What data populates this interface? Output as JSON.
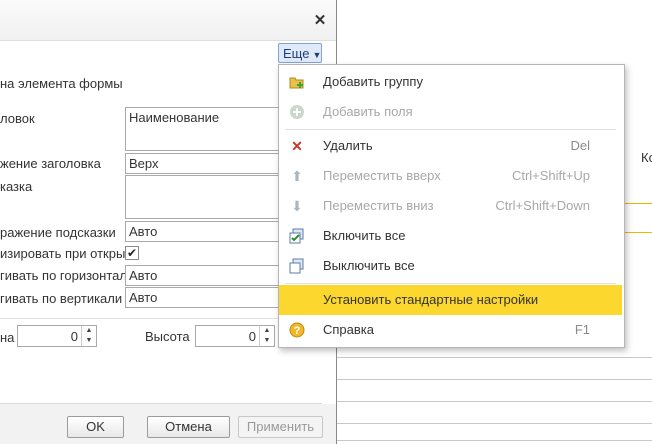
{
  "dialog": {
    "more_label": "Еще",
    "form_title": "на элемента формы",
    "labels": {
      "title": "ловок",
      "title_position": "жение заголовка",
      "hint": "казка",
      "hint_display": "ражение подсказки",
      "activate_on_open": "изировать при откры",
      "stretch_h": "гивать по горизонтал",
      "stretch_v": "гивать по вертикали",
      "width": "на",
      "height": "Высота"
    },
    "values": {
      "title": "Наименование",
      "title_position": "Верх",
      "hint": "",
      "hint_display": "Авто",
      "activate_on_open": true,
      "stretch_h": "Авто",
      "stretch_v": "Авто",
      "width": "0",
      "height": "0"
    },
    "buttons": {
      "ok": "OK",
      "cancel": "Отмена",
      "apply": "Применить"
    }
  },
  "menu": {
    "items": [
      {
        "label": "Добавить группу",
        "shortcut": "",
        "icon": "folder-add-icon",
        "enabled": true
      },
      {
        "label": "Добавить поля",
        "shortcut": "",
        "icon": "add-field-icon",
        "enabled": false
      },
      {
        "label": "Удалить",
        "shortcut": "Del",
        "icon": "delete-x-icon",
        "enabled": true
      },
      {
        "label": "Переместить вверх",
        "shortcut": "Ctrl+Shift+Up",
        "icon": "arrow-up-icon",
        "enabled": false
      },
      {
        "label": "Переместить вниз",
        "shortcut": "Ctrl+Shift+Down",
        "icon": "arrow-down-icon",
        "enabled": false
      },
      {
        "label": "Включить все",
        "shortcut": "",
        "icon": "check-all-icon",
        "enabled": true
      },
      {
        "label": "Выключить все",
        "shortcut": "",
        "icon": "uncheck-all-icon",
        "enabled": true
      },
      {
        "label": "Установить стандартные настройки",
        "shortcut": "",
        "icon": "",
        "enabled": true
      },
      {
        "label": "Справка",
        "shortcut": "F1",
        "icon": "help-icon",
        "enabled": true
      }
    ],
    "highlight_color": "#fcd82e"
  },
  "background": {
    "column_text": "Ко"
  },
  "colors": {
    "accent_yellow": "#f2b700",
    "more_button_bg": "#dfe9f8"
  }
}
